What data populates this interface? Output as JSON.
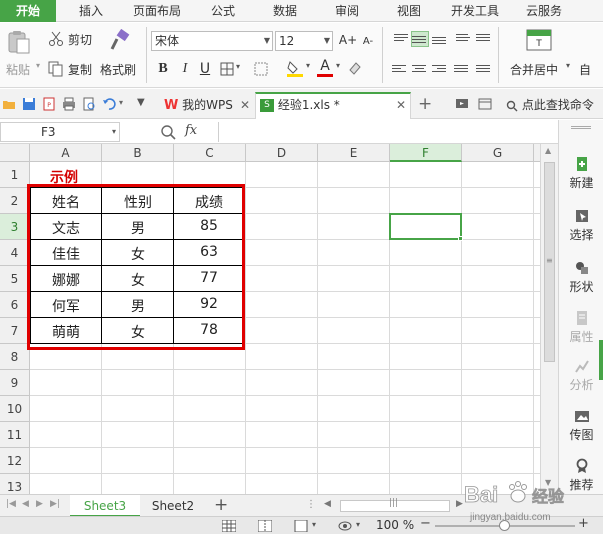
{
  "menu": {
    "items": [
      "开始",
      "插入",
      "页面布局",
      "公式",
      "数据",
      "审阅",
      "视图",
      "开发工具",
      "云服务"
    ]
  },
  "ribbon": {
    "paste": "粘贴",
    "cut": "剪切",
    "copy": "复制",
    "format_painter": "格式刷",
    "font_name": "宋体",
    "font_size": "12",
    "bold": "B",
    "italic": "I",
    "underline": "U",
    "font_color_letter": "A",
    "grow_font": "A+",
    "shrink_font": "A-",
    "merge_center": "合并居中",
    "auto_wrap_partial": "自",
    "accent_color": "#47a447",
    "fill_color": "#ffd800",
    "font_color": "#e00000"
  },
  "quickbar": {
    "tabs": [
      {
        "label": "我的WPS",
        "closable": true
      },
      {
        "label": "经验1.xls *",
        "closable": true
      }
    ],
    "add_tab": "+",
    "search": "点此查找命令"
  },
  "formula_bar": {
    "cell_ref": "F3",
    "fx": "fx",
    "value": ""
  },
  "grid": {
    "columns": [
      "A",
      "B",
      "C",
      "D",
      "E",
      "F",
      "G"
    ],
    "selected_column": "F",
    "rows": [
      "1",
      "2",
      "3",
      "4",
      "5",
      "6",
      "7",
      "8",
      "9",
      "10",
      "11",
      "12",
      "13"
    ],
    "selected_row": "3",
    "title": "示例",
    "table": {
      "headers": [
        "姓名",
        "性别",
        "成绩"
      ],
      "rows": [
        [
          "文志",
          "男",
          "85"
        ],
        [
          "佳佳",
          "女",
          "63"
        ],
        [
          "娜娜",
          "女",
          "77"
        ],
        [
          "何军",
          "男",
          "92"
        ],
        [
          "萌萌",
          "女",
          "78"
        ]
      ]
    },
    "highlight_color": "#e00000"
  },
  "taskpane": {
    "items": [
      {
        "label": "新建",
        "icon": "new-icon",
        "enabled": true
      },
      {
        "label": "选择",
        "icon": "select-icon",
        "enabled": true
      },
      {
        "label": "形状",
        "icon": "shape-icon",
        "enabled": true
      },
      {
        "label": "属性",
        "icon": "property-icon",
        "enabled": false
      },
      {
        "label": "分析",
        "icon": "analysis-icon",
        "enabled": false
      },
      {
        "label": "传图",
        "icon": "upload-image-icon",
        "enabled": true
      },
      {
        "label": "推荐",
        "icon": "recommend-icon",
        "enabled": true
      }
    ]
  },
  "sheets": {
    "tabs": [
      "Sheet3",
      "Sheet2"
    ],
    "active": "Sheet3",
    "add": "+"
  },
  "status": {
    "zoom": "100 %",
    "zoom_minus": "−",
    "zoom_plus": "+"
  },
  "watermark": {
    "brand": "Bai",
    "brand_tail": "经验",
    "url": "jingyan.baidu.com"
  }
}
